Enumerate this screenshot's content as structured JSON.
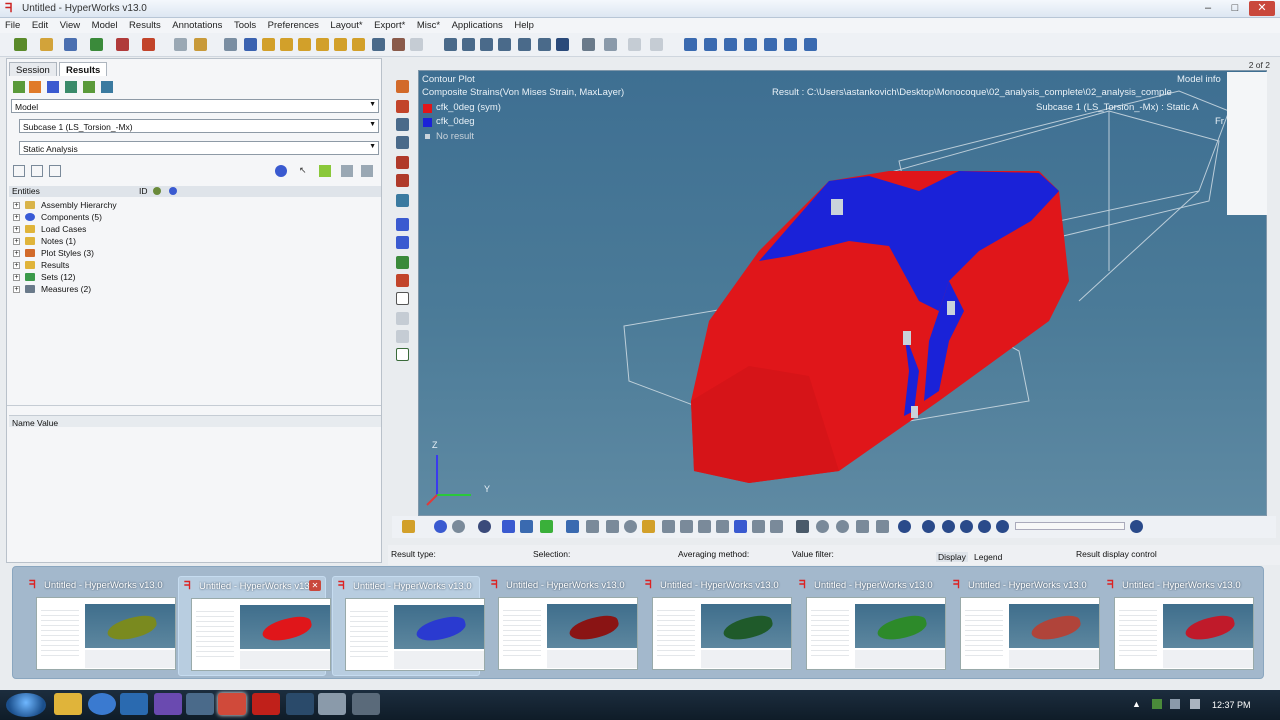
{
  "window": {
    "title": "Untitled - HyperWorks v13.0",
    "controls": [
      "–",
      "□",
      "✕"
    ]
  },
  "menu": [
    "File",
    "Edit",
    "View",
    "Model",
    "Results",
    "Annotations",
    "Tools",
    "Preferences",
    "Layout*",
    "Export*",
    "Misc*",
    "Applications",
    "Help"
  ],
  "left_panel": {
    "tabs": [
      "Session",
      "Results"
    ],
    "model_combo": "Model",
    "subcase_combo": "Subcase 1 (LS_Torsion_-Mx)",
    "analysis_combo": "Static Analysis",
    "entities_header": "Entities",
    "id_label": "ID",
    "tree": [
      {
        "label": "Assembly Hierarchy",
        "icon_color": "#d9b44a"
      },
      {
        "label": "Components (5)",
        "icon_color": "#3a5bd6"
      },
      {
        "label": "Load Cases",
        "icon_color": "#e0b43a"
      },
      {
        "label": "Notes (1)",
        "icon_color": "#e0b43a"
      },
      {
        "label": "Plot Styles (3)",
        "icon_color": "#d26a2a"
      },
      {
        "label": "Results",
        "icon_color": "#e0b43a"
      },
      {
        "label": "Sets (12)",
        "icon_color": "#3b9a4a"
      },
      {
        "label": "Measures (2)",
        "icon_color": "#6a7a8a"
      }
    ],
    "name_value_header": "Name Value"
  },
  "viewport": {
    "page_indicator": "2 of 2",
    "title": "Contour Plot",
    "subtitle": "Composite Strains(Von Mises Strain, MaxLayer)",
    "legend": [
      {
        "label": "cfk_0deg (sym)",
        "color": "#e0161a"
      },
      {
        "label": "cfk_0deg",
        "color": "#1a22d8"
      },
      {
        "label": "No result",
        "color": "#c9d3db"
      }
    ],
    "model_info": "Model info",
    "result_path": "Result : C:\\Users\\astankovich\\Desktop\\Monocoque\\02_analysis_complete\\02_analysis_comple",
    "subcase_info": "Subcase 1 (LS_Torsion_-Mx) : Static A",
    "frame": "Fr",
    "axis_z": "Z",
    "axis_y": "Y"
  },
  "bottom_panel": {
    "result_type": "Result type:",
    "selection": "Selection:",
    "averaging": "Averaging method:",
    "value_filter": "Value filter:",
    "display_tab": "Display",
    "legend_tab": "Legend",
    "result_display": "Result display control"
  },
  "thumbnails": [
    {
      "title": "Untitled - HyperWorks v13.0",
      "car_color": "#7a8a1f",
      "active": false,
      "close": false
    },
    {
      "title": "Untitled - HyperWorks v13.0",
      "car_color": "#e0161a",
      "active": true,
      "close": true
    },
    {
      "title": "Untitled - HyperWorks v13.0",
      "car_color": "#2a3ad0",
      "active": true,
      "close": false
    },
    {
      "title": "Untitled - HyperWorks v13.0",
      "car_color": "#8a1414",
      "active": false,
      "close": false
    },
    {
      "title": "Untitled - HyperWorks v13.0",
      "car_color": "#1f5a2a",
      "active": false,
      "close": false
    },
    {
      "title": "Untitled - HyperWorks v13.0",
      "car_color": "#2d8a2a",
      "active": false,
      "close": false
    },
    {
      "title": "Untitled - HyperWorks v13.0",
      "car_color": "#b0443a",
      "active": false,
      "close": false
    },
    {
      "title": "Untitled - HyperWorks v13.0",
      "car_color": "#c01a2a",
      "active": false,
      "close": false
    }
  ],
  "taskbar": {
    "clock": "12:37 PM"
  }
}
